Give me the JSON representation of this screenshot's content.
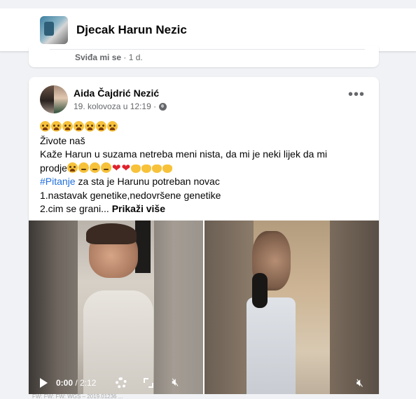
{
  "page": {
    "title": "Djecak Harun Nezic"
  },
  "previous_post": {
    "like_label": "Sviđa mi se",
    "time": "· 1 d."
  },
  "post": {
    "author": "Aida Čajdrić Nezić",
    "date": "19. kolovoza u 12:19 ·",
    "more_label": "•••",
    "text": {
      "line2": "Živote naš",
      "line3": "Kaže Harun u suzama netreba meni nista, da mi je neki lijek da mi",
      "line4_text": "prodje",
      "hashtag": "#Pitanje",
      "line5_rest": " za sta je Harunu  potreban novac",
      "line6": "1.nastavak genetike,nedovršene genetike",
      "line7": "2.cim se grani...",
      "see_more": "Prikaži više"
    },
    "video": {
      "current_time": "0:00",
      "duration": "/ 2:12"
    }
  },
  "footer": {
    "fragment": "FW: FW: FW: WGS – 2019.01236 ..."
  },
  "icons": {
    "globe": "globe-icon",
    "settings": "gear-icon",
    "fullscreen": "expand-icon",
    "mute": "volume-mute-icon",
    "play": "play-icon"
  },
  "colors": {
    "hashtag": "#216fdb",
    "secondary_text": "#65676b",
    "heart": "#e0222d"
  }
}
